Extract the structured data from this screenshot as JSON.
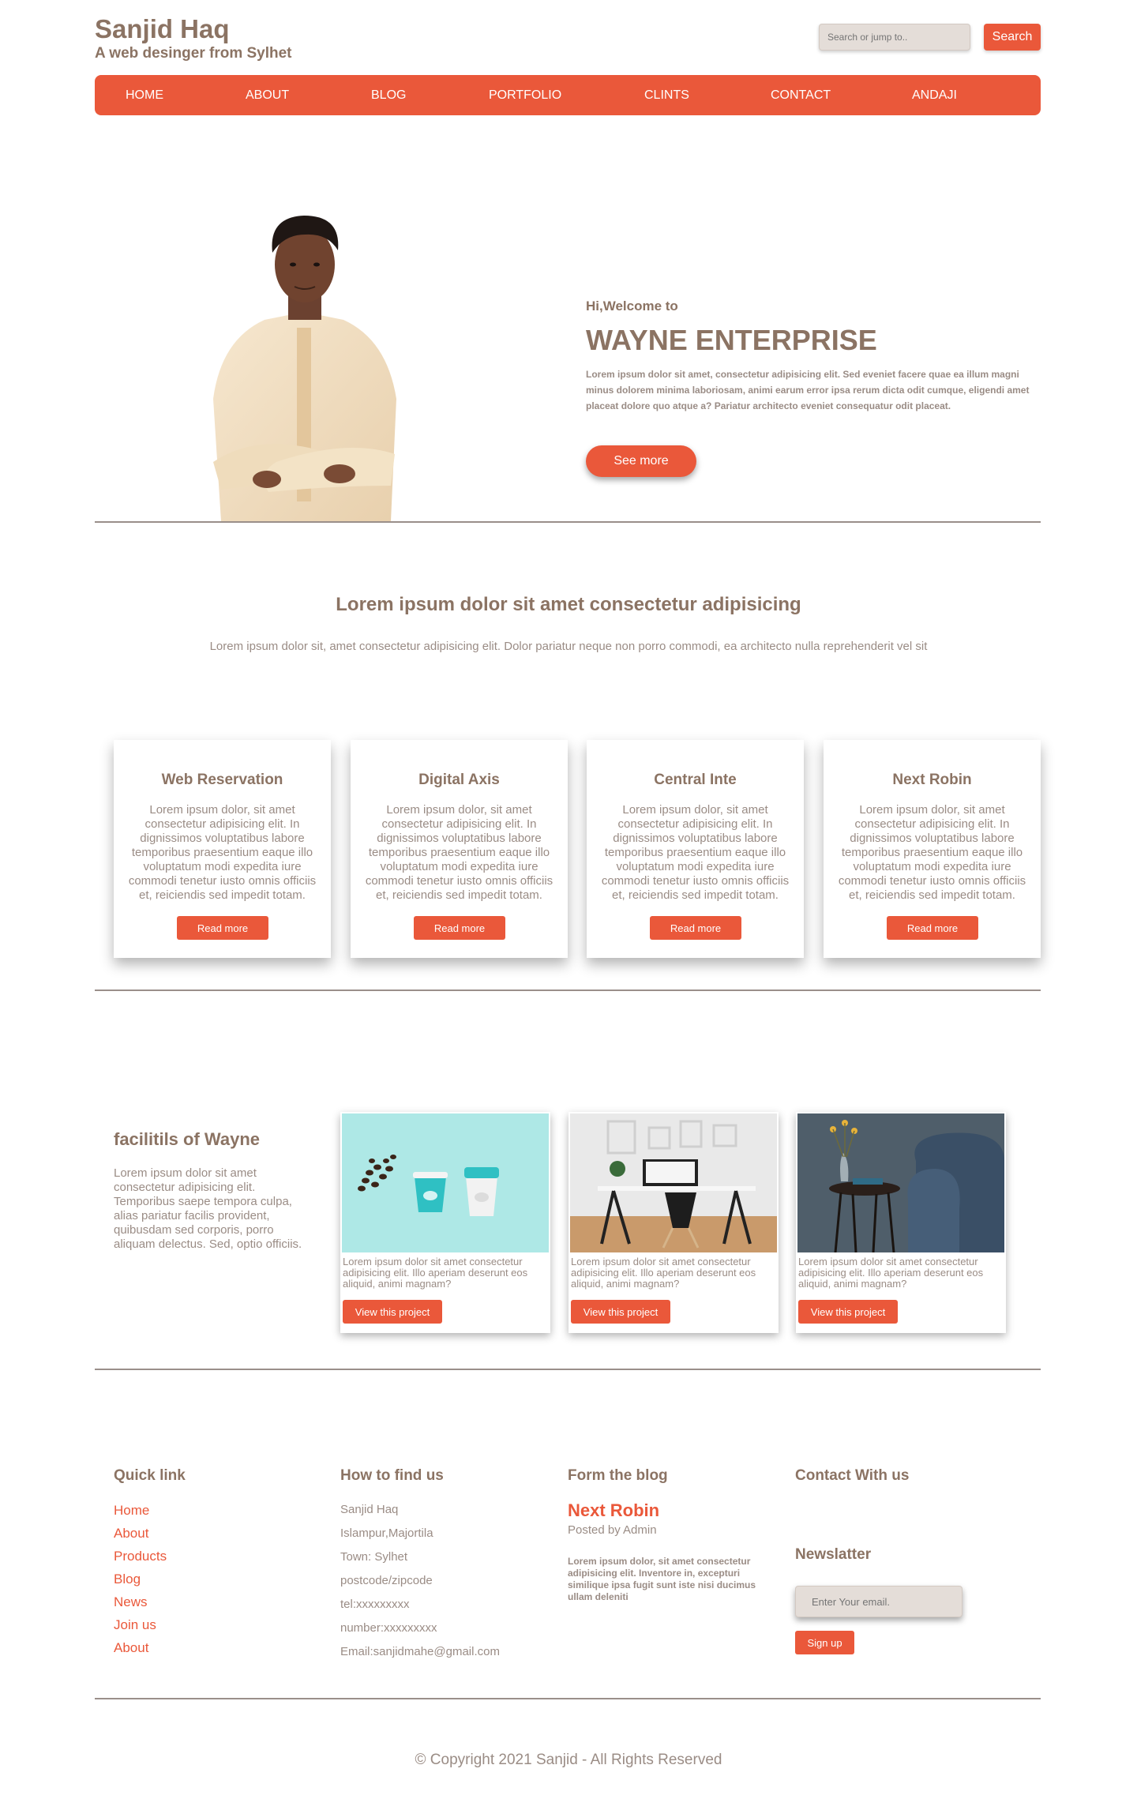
{
  "header": {
    "title": "Sanjid Haq",
    "subtitle": "A web desinger from Sylhet",
    "search_placeholder": "Search or jump to..",
    "search_button": "Search"
  },
  "nav": {
    "items": [
      "HOME",
      "ABOUT",
      "BLOG",
      "PORTFOLIO",
      "CLINTS",
      "CONTACT",
      "ANDAJI"
    ]
  },
  "hero": {
    "greeting": "Hi,Welcome to",
    "title": "WAYNE ENTERPRISE",
    "text": "Lorem ipsum dolor sit amet, consectetur adipisicing elit. Sed eveniet facere quae ea illum magni minus dolorem minima laboriosam, animi earum error ipsa rerum dicta odit cumque, eligendi amet placeat dolore quo atque a? Pariatur architecto eveniet consequatur odit placeat.",
    "button": "See more"
  },
  "intro": {
    "title": "Lorem ipsum dolor sit amet consectetur adipisicing",
    "text": "Lorem ipsum dolor sit, amet consectetur adipisicing elit. Dolor pariatur neque non porro commodi, ea architecto nulla reprehenderit vel sit"
  },
  "cards": [
    {
      "title": "Web Reservation",
      "text": "Lorem ipsum dolor, sit amet consectetur adipisicing elit. In dignissimos voluptatibus labore temporibus praesentium eaque illo voluptatum modi expedita iure commodi tenetur iusto omnis officiis et, reiciendis sed impedit totam.",
      "button": "Read more"
    },
    {
      "title": "Digital Axis",
      "text": "Lorem ipsum dolor, sit amet consectetur adipisicing elit. In dignissimos voluptatibus labore temporibus praesentium eaque illo voluptatum modi expedita iure commodi tenetur iusto omnis officiis et, reiciendis sed impedit totam.",
      "button": "Read more"
    },
    {
      "title": "Central Inte",
      "text": "Lorem ipsum dolor, sit amet consectetur adipisicing elit. In dignissimos voluptatibus labore temporibus praesentium eaque illo voluptatum modi expedita iure commodi tenetur iusto omnis officiis et, reiciendis sed impedit totam.",
      "button": "Read more"
    },
    {
      "title": "Next Robin",
      "text": "Lorem ipsum dolor, sit amet consectetur adipisicing elit. In dignissimos voluptatibus labore temporibus praesentium eaque illo voluptatum modi expedita iure commodi tenetur iusto omnis officiis et, reiciendis sed impedit totam.",
      "button": "Read more"
    }
  ],
  "facilities": {
    "title": "facilitils of Wayne",
    "text": "Lorem ipsum dolor sit amet consectetur adipisicing elit. Temporibus saepe tempora culpa, alias pariatur facilis provident, quibusdam sed corporis, porro aliquam delectus. Sed, optio officiis.",
    "projects": [
      {
        "text": "Lorem ipsum dolor sit amet consectetur adipisicing elit. Illo aperiam deserunt eos aliquid, animi magnam?",
        "button": "View this project"
      },
      {
        "text": "Lorem ipsum dolor sit amet consectetur adipisicing elit. Illo aperiam deserunt eos aliquid, animi magnam?",
        "button": "View this project"
      },
      {
        "text": "Lorem ipsum dolor sit amet consectetur adipisicing elit. Illo aperiam deserunt eos aliquid, animi magnam?",
        "button": "View this project"
      }
    ]
  },
  "footer": {
    "quick_link": {
      "heading": "Quick link",
      "links": [
        "Home",
        "About",
        "Products",
        "Blog",
        "News",
        "Join us",
        "About"
      ]
    },
    "find_us": {
      "heading": "How to find us",
      "lines": [
        "Sanjid Haq",
        "Islampur,Majortila",
        "Town: Sylhet",
        "postcode/zipcode",
        "tel:xxxxxxxxx",
        "number:xxxxxxxxx",
        "Email:sanjidmahe@gmail.com"
      ]
    },
    "blog": {
      "heading": "Form the blog",
      "post_title": "Next Robin",
      "posted_by": "Posted by Admin",
      "text": "Lorem ipsum dolor, sit amet consectetur adipisicing elit. Inventore in, excepturi similique ipsa fugit sunt iste nisi ducimus ullam deleniti"
    },
    "contact": {
      "heading": "Contact With us",
      "newsletter_heading": "Newslatter",
      "email_placeholder": "Enter Your email.",
      "signup_button": "Sign up"
    },
    "copyright": "© Copyright 2021 Sanjid - All Rights Reserved"
  },
  "colors": {
    "accent": "#ea583a",
    "heading": "#8b7363",
    "muted": "#9a8c85"
  }
}
